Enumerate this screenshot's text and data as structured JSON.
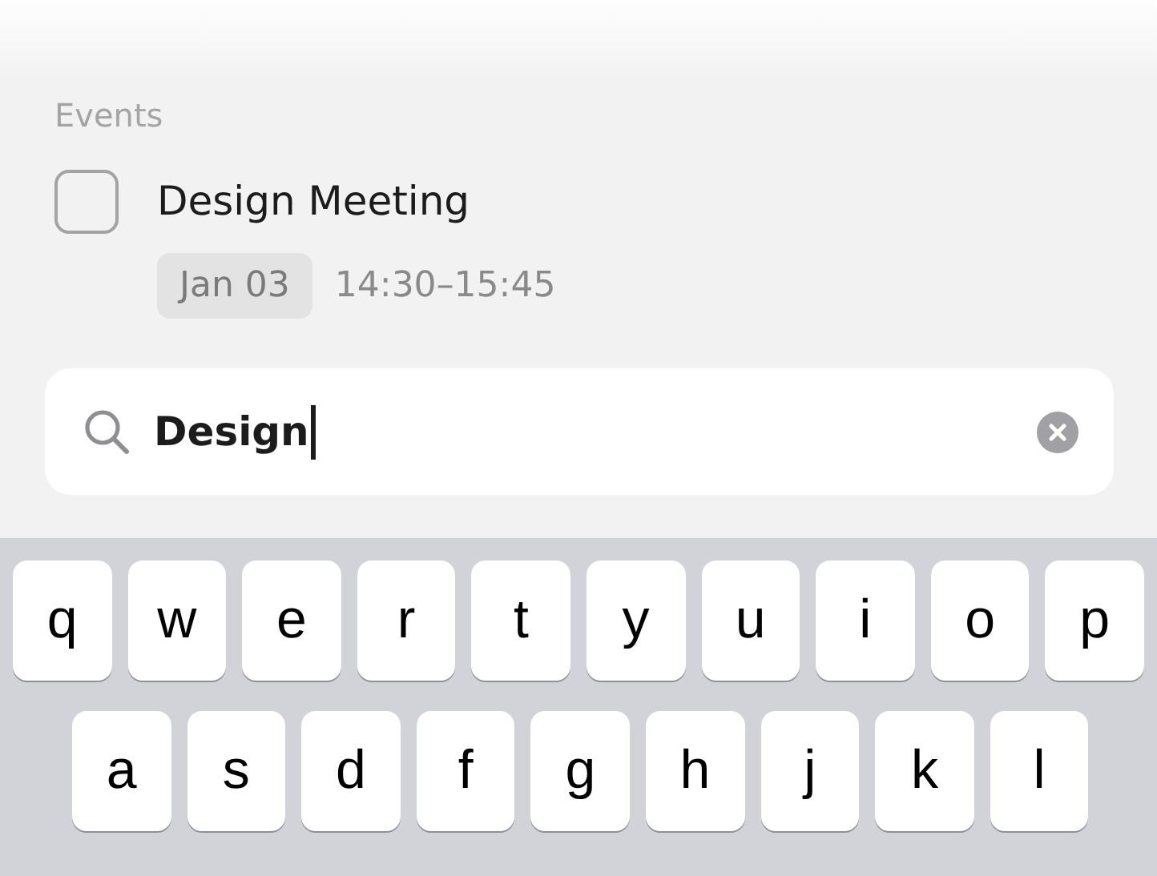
{
  "events": {
    "header": "Events",
    "items": [
      {
        "title": "Design Meeting",
        "checked": false,
        "date": "Jan 03",
        "time": "14:30–15:45"
      }
    ]
  },
  "search": {
    "value": "Design",
    "focused": true
  },
  "keyboard": {
    "rows": [
      [
        "q",
        "w",
        "e",
        "r",
        "t",
        "y",
        "u",
        "i",
        "o",
        "p"
      ],
      [
        "a",
        "s",
        "d",
        "f",
        "g",
        "h",
        "j",
        "k",
        "l"
      ]
    ]
  }
}
